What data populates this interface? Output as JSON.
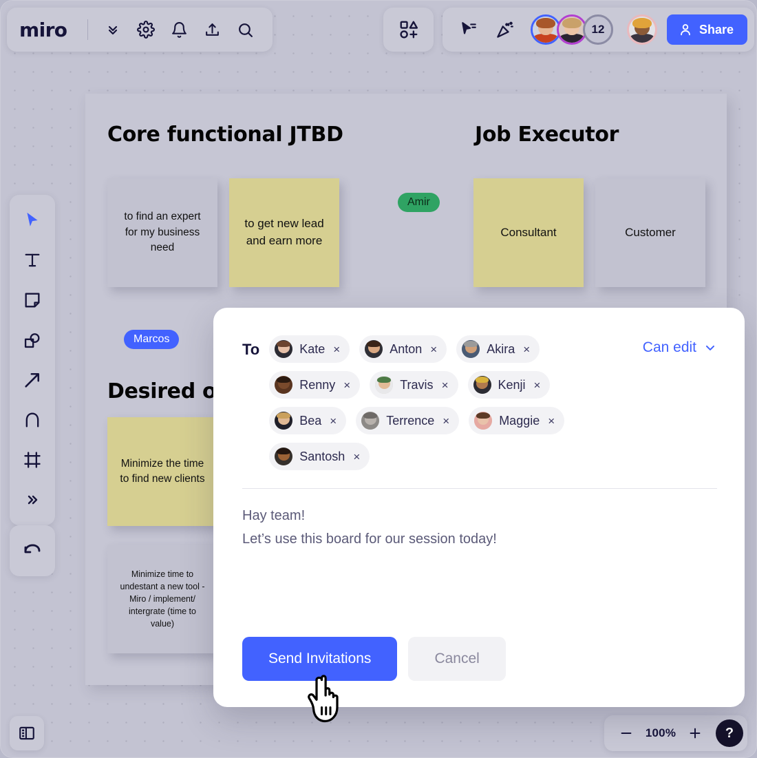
{
  "app": {
    "name": "miro",
    "background_color": "#c3c3d2",
    "accent_color": "#4262ff"
  },
  "topbar": {
    "logo": "miro",
    "left_icons": [
      {
        "name": "chevrons-down-icon",
        "label": "Board menu"
      },
      {
        "name": "gear-icon",
        "label": "Settings"
      },
      {
        "name": "bell-icon",
        "label": "Notifications"
      },
      {
        "name": "upload-icon",
        "label": "Upload / Export"
      },
      {
        "name": "search-icon",
        "label": "Search"
      }
    ],
    "shapes_button": {
      "name": "shapes-add-icon",
      "label": "Shapes"
    },
    "right_icons": [
      {
        "name": "cursor-chat-icon",
        "label": "Cursor chat"
      },
      {
        "name": "celebrate-icon",
        "label": "Reactions"
      }
    ],
    "collaborators": [
      {
        "name": "Collaborator 1",
        "ring": "#4262ff"
      },
      {
        "name": "Collaborator 2",
        "ring": "#b23fd0"
      }
    ],
    "collaborator_overflow": "12",
    "self_avatar": {
      "name": "You",
      "ring": "#eab9bd"
    },
    "share_label": "Share"
  },
  "tools": [
    {
      "name": "select-tool",
      "icon": "cursor-arrow-icon",
      "label": "Select",
      "active": true
    },
    {
      "name": "text-tool",
      "icon": "text-t-icon",
      "label": "Text"
    },
    {
      "name": "sticky-note-tool",
      "icon": "sticky-note-icon",
      "label": "Sticky note"
    },
    {
      "name": "shapes-tool",
      "icon": "shapes-icon",
      "label": "Shapes"
    },
    {
      "name": "connection-tool",
      "icon": "arrow-icon",
      "label": "Connection line"
    },
    {
      "name": "pen-tool",
      "icon": "pen-a-icon",
      "label": "Pen"
    },
    {
      "name": "frame-tool",
      "icon": "frame-icon",
      "label": "Frame"
    },
    {
      "name": "more-tools",
      "icon": "chevrons-right-icon",
      "label": "More tools"
    }
  ],
  "undo": {
    "name": "undo-button",
    "icon": "undo-arrow-icon",
    "label": "Undo"
  },
  "panel_toggle": {
    "name": "panel-toggle-button",
    "icon": "side-panel-icon",
    "label": "Toggle panel"
  },
  "zoom_bar": {
    "minus_label": "−",
    "level": "100%",
    "plus_label": "+",
    "help_label": "?"
  },
  "board": {
    "headings": [
      {
        "id": "core",
        "text": "Core functional JTBD"
      },
      {
        "id": "executor",
        "text": "Job Executor"
      },
      {
        "id": "desired",
        "text": "Desired o"
      }
    ],
    "notes": [
      {
        "id": "expert",
        "text": "to find an expert for my business need",
        "color": "grey",
        "hex": "#c2c2d0"
      },
      {
        "id": "lead",
        "text": "to get new lead and earn more",
        "color": "yellow",
        "hex": "#d6cf91"
      },
      {
        "id": "consultant",
        "text": "Consultant",
        "color": "yellow",
        "hex": "#d6cf91"
      },
      {
        "id": "customer",
        "text": "Customer",
        "color": "grey",
        "hex": "#c2c2d0"
      },
      {
        "id": "minimize",
        "text": "Minimize the time to find new clients",
        "color": "yellow",
        "hex": "#d6cf91"
      },
      {
        "id": "undestant",
        "text": "Minimize time to undestant a new tool - Miro / implement/ intergrate (time to value)",
        "color": "grey",
        "hex": "#c2c2d0"
      }
    ],
    "cursors": [
      {
        "id": "amir",
        "name": "Amir",
        "color": "#2fa363"
      },
      {
        "id": "marcos",
        "name": "Marcos",
        "color": "#4262ff"
      }
    ]
  },
  "invite_modal": {
    "to_label": "To",
    "recipients": [
      {
        "name": "Kate",
        "remove": "×",
        "skin": "#e6c0a8",
        "hair": "#6b4430",
        "shirt": "#2b2b33"
      },
      {
        "name": "Anton",
        "remove": "×",
        "skin": "#d9a781",
        "hair": "#3a2418",
        "shirt": "#2f2f36"
      },
      {
        "name": "Akira",
        "remove": "×",
        "skin": "#cf9f78",
        "hair": "#9a9a9a",
        "shirt": "#4a5b74"
      },
      {
        "name": "Renny",
        "remove": "×",
        "skin": "#7a4a2c",
        "hair": "#2b1a10",
        "shirt": "#5a3520"
      },
      {
        "name": "Travis",
        "remove": "×",
        "skin": "#e3bb97",
        "hair": "#4d7a45",
        "shirt": "#e8e8ea"
      },
      {
        "name": "Kenji",
        "remove": "×",
        "skin": "#b07a4e",
        "hair": "#d8b23c",
        "shirt": "#2b2b33"
      },
      {
        "name": "Bea",
        "remove": "×",
        "skin": "#e0b894",
        "hair": "#caa05c",
        "shirt": "#20202a"
      },
      {
        "name": "Terrence",
        "remove": "×",
        "skin": "#b8b2ad",
        "hair": "#6e6a67",
        "shirt": "#8d8a87"
      },
      {
        "name": "Maggie",
        "remove": "×",
        "skin": "#e9c2aa",
        "hair": "#5c3a26",
        "shirt": "#e6a9a2"
      },
      {
        "name": "Santosh",
        "remove": "×",
        "skin": "#9c6236",
        "hair": "#241610",
        "shirt": "#35302c"
      }
    ],
    "permission": {
      "label": "Can edit",
      "chevron": "chevron-down-icon"
    },
    "message": "Hay team!\nLet’s use this board for our session today!",
    "send_label": "Send Invitations",
    "cancel_label": "Cancel"
  }
}
